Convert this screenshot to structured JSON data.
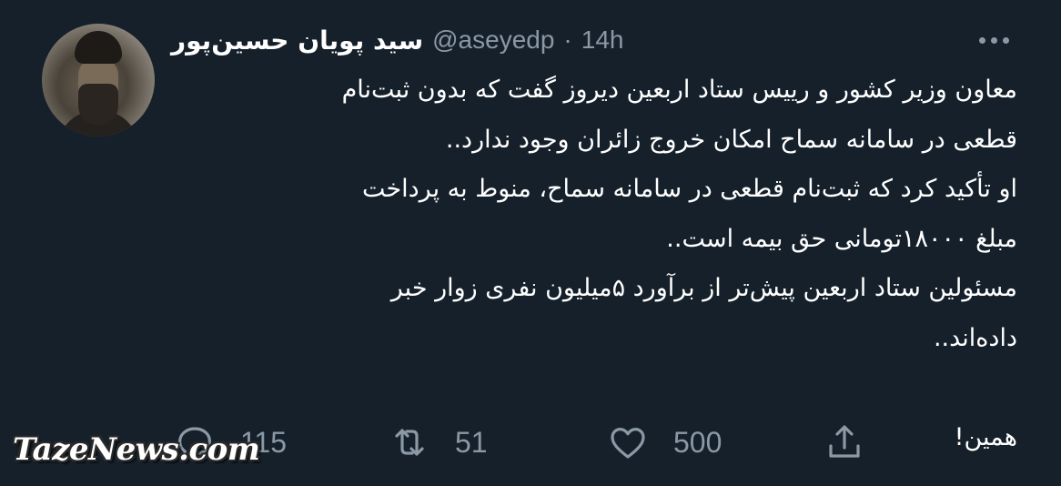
{
  "tweet": {
    "author": {
      "display_name": "سید پویان حسین‌پور",
      "handle": "@aseyedp",
      "separator": "·",
      "time": "14h"
    },
    "more_icon": "more-horizontal-icon",
    "body_lines": [
      "معاون وزیر کشور و رییس ستاد اربعین دیروز گفت که بدون ثبت‌نام",
      "قطعی در سامانه سماح امکان خروج زائران وجود ندارد..",
      "او تأکید کرد که ثبت‌نام قطعی در سامانه سماح، منوط به پرداخت",
      "مبلغ ۱۸۰۰۰تومانی حق بیمه است..",
      "مسئولین ستاد اربعین پیش‌تر از برآورد ۵میلیون نفری زوار خبر",
      "داده‌اند..",
      "",
      "همین!"
    ],
    "actions": {
      "reply": {
        "icon": "reply-icon",
        "count": "115"
      },
      "retweet": {
        "icon": "retweet-icon",
        "count": "51"
      },
      "like": {
        "icon": "heart-icon",
        "count": "500"
      },
      "share": {
        "icon": "share-icon"
      }
    }
  },
  "watermark": "TazeNews.com",
  "colors": {
    "background": "#15202b",
    "text": "#ffffff",
    "secondary": "#8b98a5"
  }
}
